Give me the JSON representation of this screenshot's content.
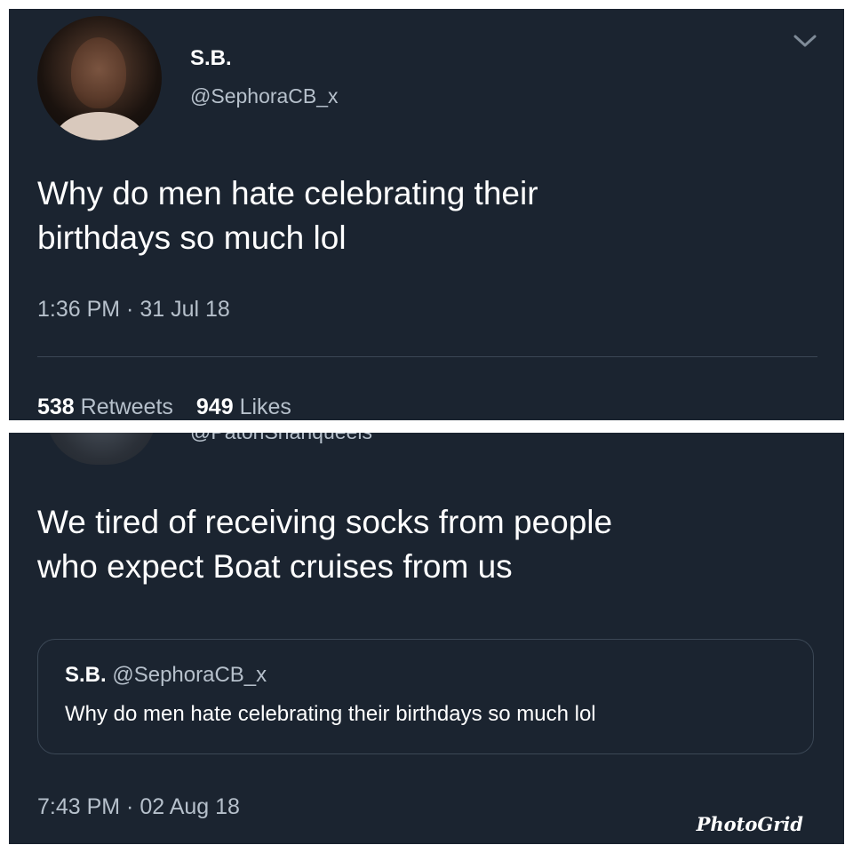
{
  "top_tweet": {
    "author_name": "S.B.",
    "author_handle": "@SephoraCB_x",
    "text_line1": "Why do men hate celebrating their",
    "text_line2": "birthdays so much lol",
    "timestamp": "1:36 PM · 31 Jul 18",
    "retweets_count": "538",
    "retweets_label": "Retweets",
    "likes_count": "949",
    "likes_label": "Likes",
    "menu_icon": "chevron-down-icon"
  },
  "bottom_tweet": {
    "author_handle_cut": "@PatonShanqueels",
    "text_line1": "We tired of receiving socks from people",
    "text_line2": "who expect Boat cruises from us",
    "quoted": {
      "author_name": "S.B.",
      "author_handle": "@SephoraCB_x",
      "text": "Why do men hate celebrating their birthdays so much lol"
    },
    "timestamp": "7:43 PM · 02 Aug 18"
  },
  "watermark": "PhotoGrid",
  "colors": {
    "background": "#1b2430",
    "text_primary": "#ffffff",
    "text_secondary": "#b6c0cb",
    "divider": "#3b4755"
  }
}
